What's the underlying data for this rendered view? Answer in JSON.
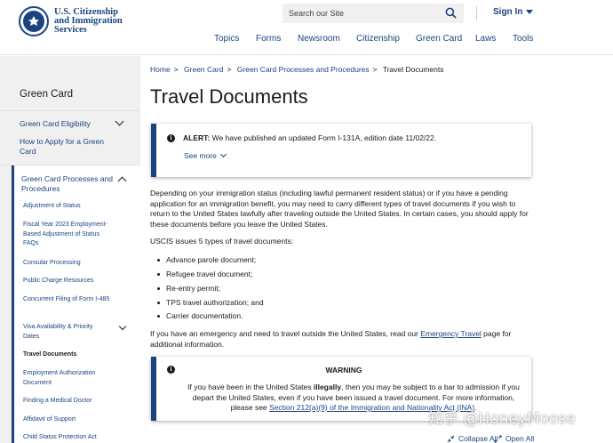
{
  "header": {
    "agency_line1": "U.S. Citizenship",
    "agency_line2": "and Immigration",
    "agency_line3": "Services",
    "search_placeholder": "Search our Site",
    "signin_label": "Sign In",
    "nav": [
      "Topics",
      "Forms",
      "Newsroom",
      "Citizenship",
      "Green Card",
      "Laws",
      "Tools"
    ]
  },
  "sidebar": {
    "title": "Green Card",
    "items": [
      {
        "label": "Green Card Eligibility"
      },
      {
        "label": "How to Apply for a Green Card"
      },
      {
        "label": "Green Card Processes and Procedures"
      }
    ],
    "subitems": [
      {
        "label": "Adjustment of Status"
      },
      {
        "label": "Fiscal Year 2023 Employment-Based Adjustment of Status FAQs"
      },
      {
        "label": "Consular Processing"
      },
      {
        "label": "Public Charge Resources"
      },
      {
        "label": "Concurrent Filing of Form I-485"
      },
      {
        "label": "Visa Availability & Priority Dates"
      },
      {
        "label": "Travel Documents"
      },
      {
        "label": "Employment Authorization Document"
      },
      {
        "label": "Finding a Medical Doctor"
      },
      {
        "label": "Affidavit of Support"
      },
      {
        "label": "Child Status Protection Act"
      }
    ]
  },
  "breadcrumb": [
    "Home",
    "Green Card",
    "Green Card Processes and Procedures",
    "Travel Documents"
  ],
  "page_title": "Travel Documents",
  "alert": {
    "label": "ALERT:",
    "text": " We have published an updated Form I-131A, edition date 11/02/22.",
    "see_more": "See more"
  },
  "body": {
    "para1": "Depending on your immigration status (including lawful permanent resident status) or if you have a pending application for an immigration benefit, you may need to carry different types of travel documents if you wish to return to the United States lawfully after traveling outside the United States. In certain cases, you should apply for these documents before you leave the United States.",
    "para2": "USCIS issues 5 types of travel documents:",
    "bullets": [
      "Advance parole document;",
      "Refugee travel document;",
      "Re-entry permit;",
      "TPS travel authorization; and",
      "Carrier documentation."
    ],
    "para3_before": "If you have an emergency and need to travel outside the United States, read our ",
    "para3_link": "Emergency Travel",
    "para3_after": " page for additional information."
  },
  "warning": {
    "title": "WARNING",
    "text_before": "If you have been in the United States ",
    "text_bold": "illegally",
    "text_mid": ", then you may be subject to a bar to admission if you depart the United States, even if you have been issued a travel document. For more information, please see ",
    "link": "Section 212(a)(9) of the Immigration and Nationality Act (INA)",
    "text_after": "."
  },
  "controls": {
    "collapse_all": "Collapse All",
    "open_all": "Open All"
  },
  "watermark": "知乎 @HoneyMoose",
  "colors": {
    "brand": "#1a4480",
    "sidebar_bg": "#f0f0f0",
    "text": "#1b1b1b"
  }
}
